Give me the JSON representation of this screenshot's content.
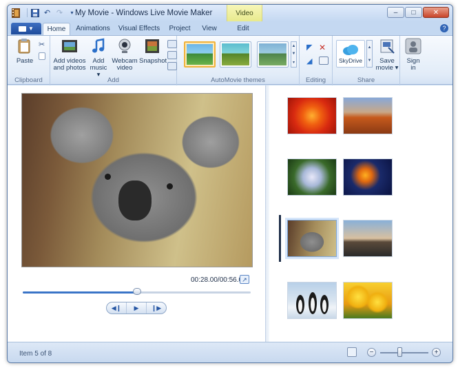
{
  "titlebar": {
    "title": "My Movie - Windows Live Movie Maker",
    "contextual_tab": "Video Tools",
    "qat_icons": [
      "save-icon",
      "undo-icon",
      "redo-icon",
      "customize-qat-icon"
    ]
  },
  "tabs": {
    "home": "Home",
    "animations": "Animations",
    "visual_effects": "Visual Effects",
    "project": "Project",
    "view": "View",
    "edit": "Edit"
  },
  "ribbon": {
    "clipboard": {
      "paste": "Paste",
      "label": "Clipboard"
    },
    "add": {
      "add_videos_line1": "Add videos",
      "add_videos_line2": "and photos",
      "add_music_line1": "Add",
      "add_music_line2": "music ▾",
      "webcam_line1": "Webcam",
      "webcam_line2": "video",
      "snapshot": "Snapshot",
      "label": "Add"
    },
    "themes": {
      "label": "AutoMovie themes"
    },
    "editing": {
      "label": "Editing"
    },
    "share": {
      "skydrive": "SkyDrive",
      "save_movie_line1": "Save",
      "save_movie_line2": "movie ▾",
      "label": "Share"
    },
    "signin": {
      "line1": "Sign",
      "line2": "in"
    }
  },
  "preview": {
    "timecode": "00:28.00/00:56.00",
    "progress": 0.5
  },
  "storyboard": {
    "selected_index": 4,
    "item_count": 8
  },
  "statusbar": {
    "text": "Item 5 of 8"
  },
  "colors": {
    "accent": "#3a74c7",
    "contextual_tab": "#e8ea8e",
    "close_button": "#c8442a"
  }
}
